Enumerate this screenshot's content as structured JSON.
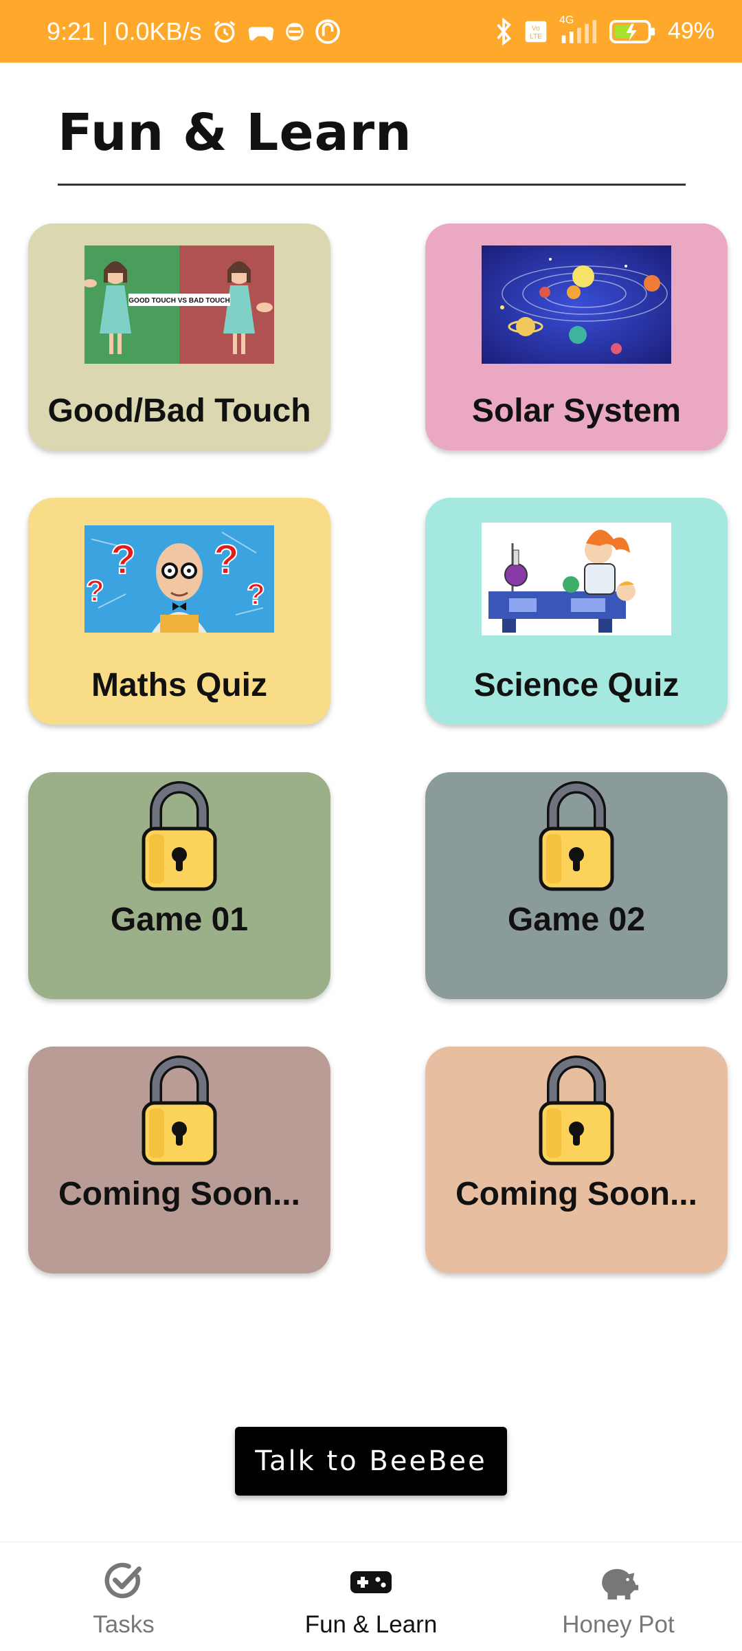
{
  "status_bar": {
    "time_and_speed": "9:21 | 0.0KB/s",
    "network_type": "4G",
    "battery": "49%"
  },
  "page": {
    "title": "Fun & Learn"
  },
  "cards": [
    {
      "label": "Good/Bad Touch",
      "bg": "#dbd8b1",
      "thumb_caption": "GOOD TOUCH VS BAD TOUCH"
    },
    {
      "label": "Solar System",
      "bg": "#eaa8c2"
    },
    {
      "label": "Maths Quiz",
      "bg": "#f8dc88"
    },
    {
      "label": "Science Quiz",
      "bg": "#a5e8e0"
    },
    {
      "label": "Game 01",
      "bg": "#9bb089",
      "locked": true
    },
    {
      "label": "Game 02",
      "bg": "#8b9a9b",
      "locked": true
    },
    {
      "label": "Coming Soon...",
      "bg": "#b89c95",
      "locked": true
    },
    {
      "label": "Coming Soon...",
      "bg": "#e7bea0",
      "locked": true
    }
  ],
  "cta": {
    "label": "Talk to BeeBee"
  },
  "bottom_nav": {
    "items": [
      {
        "label": "Tasks",
        "icon": "check-circle-icon"
      },
      {
        "label": "Fun & Learn",
        "icon": "gamepad-icon",
        "active": true
      },
      {
        "label": "Honey Pot",
        "icon": "piggy-bank-icon"
      }
    ]
  },
  "colors": {
    "status_bar": "#fea92c",
    "cta_background": "#000000",
    "lock_body": "#fbd35a",
    "lock_shackle": "#6f7380"
  }
}
